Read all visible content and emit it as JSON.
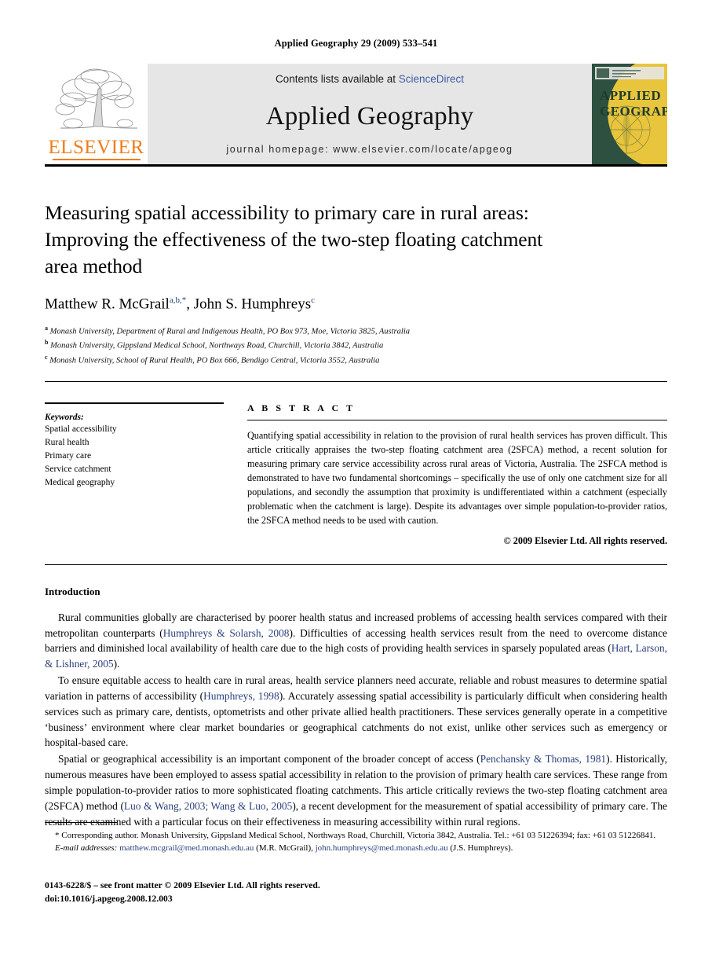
{
  "running_head": "Applied Geography 29 (2009) 533–541",
  "header": {
    "contents_prefix": "Contents lists available at ",
    "sciencedirect": "ScienceDirect",
    "journal_name": "Applied Geography",
    "homepage": "journal homepage: www.elsevier.com/locate/apgeog",
    "publisher_wordmark": "ELSEVIER",
    "cover": {
      "line1": "APPLIED",
      "line2": "GEOGRAPHY",
      "bg_color": "#2d5040",
      "disc_color": "#e8c53c",
      "band_color": "#e6e6e6"
    },
    "link_color": "#3b5ca8"
  },
  "title": {
    "line1": "Measuring spatial accessibility to primary care in rural areas:",
    "line2": "Improving the effectiveness of the two-step floating catchment",
    "line3": "area method"
  },
  "authors": {
    "a1_name": "Matthew R. McGrail",
    "a1_sup": "a,b,*",
    "separator": ", ",
    "a2_name": "John S. Humphreys",
    "a2_sup": "c"
  },
  "affiliations": [
    {
      "marker": "a",
      "text": "Monash University, Department of Rural and Indigenous Health, PO Box 973, Moe, Victoria 3825, Australia"
    },
    {
      "marker": "b",
      "text": "Monash University, Gippsland Medical School, Northways Road, Churchill, Victoria 3842, Australia"
    },
    {
      "marker": "c",
      "text": "Monash University, School of Rural Health, PO Box 666, Bendigo Central, Victoria 3552, Australia"
    }
  ],
  "keywords": {
    "heading": "Keywords:",
    "items": [
      "Spatial accessibility",
      "Rural health",
      "Primary care",
      "Service catchment",
      "Medical geography"
    ]
  },
  "abstract": {
    "heading": "A B S T R A C T",
    "body": "Quantifying spatial accessibility in relation to the provision of rural health services has proven difficult. This article critically appraises the two-step floating catchment area (2SFCA) method, a recent solution for measuring primary care service accessibility across rural areas of Victoria, Australia. The 2SFCA method is demonstrated to have two fundamental shortcomings – specifically the use of only one catchment size for all populations, and secondly the assumption that proximity is undifferentiated within a catchment (especially problematic when the catchment is large). Despite its advantages over simple population-to-provider ratios, the 2SFCA method needs to be used with caution.",
    "copyright": "© 2009 Elsevier Ltd. All rights reserved."
  },
  "introduction": {
    "heading": "Introduction",
    "p1_a": "Rural communities globally are characterised by poorer health status and increased problems of accessing health services compared with their metropolitan counterparts (",
    "p1_cite1": "Humphreys & Solarsh, 2008",
    "p1_b": "). Difficulties of accessing health services result from the need to overcome distance barriers and diminished local availability of health care due to the high costs of providing health services in sparsely populated areas (",
    "p1_cite2": "Hart, Larson, & Lishner, 2005",
    "p1_c": ").",
    "p2_a": "To ensure equitable access to health care in rural areas, health service planners need accurate, reliable and robust measures to determine spatial variation in patterns of accessibility (",
    "p2_cite1": "Humphreys, 1998",
    "p2_b": "). Accurately assessing spatial accessibility is particularly difficult when considering health services such as primary care, dentists, optometrists and other private allied health practitioners. These services generally operate in a competitive ‘business’ environment where clear market boundaries or geographical catchments do not exist, unlike other services such as emergency or hospital-based care.",
    "p3_a": "Spatial or geographical accessibility is an important component of the broader concept of access (",
    "p3_cite1": "Penchansky & Thomas, 1981",
    "p3_b": "). Historically, numerous measures have been employed to assess spatial accessibility in relation to the provision of primary health care services. These range from simple population-to-provider ratios to more sophisticated floating catchments. This article critically reviews the two-step floating catchment area (2SFCA) method (",
    "p3_cite2": "Luo & Wang, 2003; Wang & Luo, 2005",
    "p3_c": "), a recent development for the measurement of spatial accessibility of primary care. The results are examined with a particular focus on their effectiveness in measuring accessibility within rural regions."
  },
  "footnotes": {
    "corresponding": "* Corresponding author. Monash University, Gippsland Medical School, Northways Road, Churchill, Victoria 3842, Australia. Tel.: +61 03 51226394; fax: +61 03 51226841.",
    "email_label": "E-mail addresses:",
    "email1": "matthew.mcgrail@med.monash.edu.au",
    "email1_owner": " (M.R. McGrail), ",
    "email2": "john.humphreys@med.monash.edu.au",
    "email2_owner": " (J.S. Humphreys)."
  },
  "imprint": {
    "line1": "0143-6228/$ – see front matter © 2009 Elsevier Ltd. All rights reserved.",
    "line2": "doi:10.1016/j.apgeog.2008.12.003"
  }
}
